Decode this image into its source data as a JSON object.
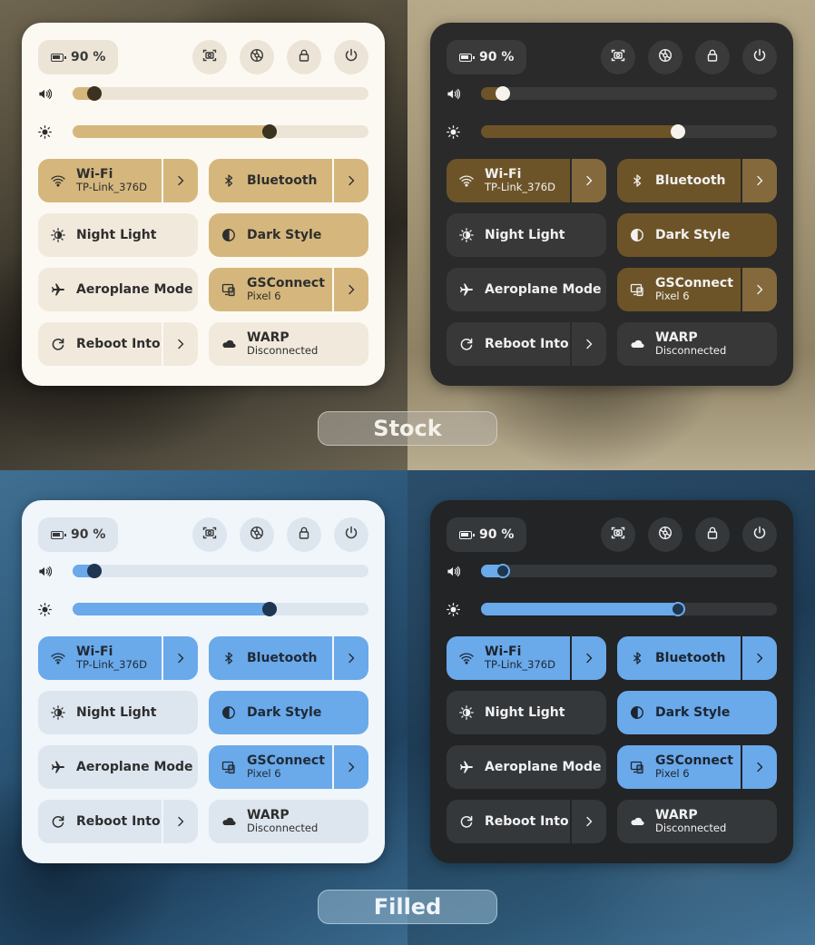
{
  "battery_label": "90 %",
  "volume_level": 0.075,
  "brightness_level": 0.665,
  "tiles": [
    {
      "key": "wifi",
      "title": "Wi-Fi",
      "subtitle": "TP-Link_376D",
      "icon": "wifi-icon",
      "active": true,
      "arrow": true
    },
    {
      "key": "bluetooth",
      "title": "Bluetooth",
      "subtitle": "",
      "icon": "bluetooth-icon",
      "active": true,
      "arrow": true
    },
    {
      "key": "night-light",
      "title": "Night Light",
      "subtitle": "",
      "icon": "night-light-icon",
      "active": false,
      "arrow": false
    },
    {
      "key": "dark-style",
      "title": "Dark Style",
      "subtitle": "",
      "icon": "dark-style-icon",
      "active": true,
      "arrow": false
    },
    {
      "key": "aeroplane-mode",
      "title": "Aeroplane Mode",
      "subtitle": "",
      "icon": "aeroplane-icon",
      "active": false,
      "arrow": false
    },
    {
      "key": "gsconnect",
      "title": "GSConnect",
      "subtitle": "Pixel 6",
      "icon": "gsconnect-icon",
      "active": true,
      "arrow": true
    },
    {
      "key": "reboot-into",
      "title": "Reboot Into",
      "subtitle": "",
      "icon": "reboot-icon",
      "active": false,
      "arrow": true
    },
    {
      "key": "warp",
      "title": "WARP",
      "subtitle": "Disconnected",
      "icon": "cloud-icon",
      "active": false,
      "arrow": false
    }
  ],
  "top_buttons": [
    "screenshot-icon",
    "settings-icon",
    "lock-icon",
    "power-icon"
  ],
  "labels": {
    "stock": "Stock",
    "filled": "Filled"
  },
  "colors": {
    "stock_accent_light": "#d5b77d",
    "stock_accent_dark": "#6d5428",
    "filled_accent": "#6aa9ea"
  }
}
